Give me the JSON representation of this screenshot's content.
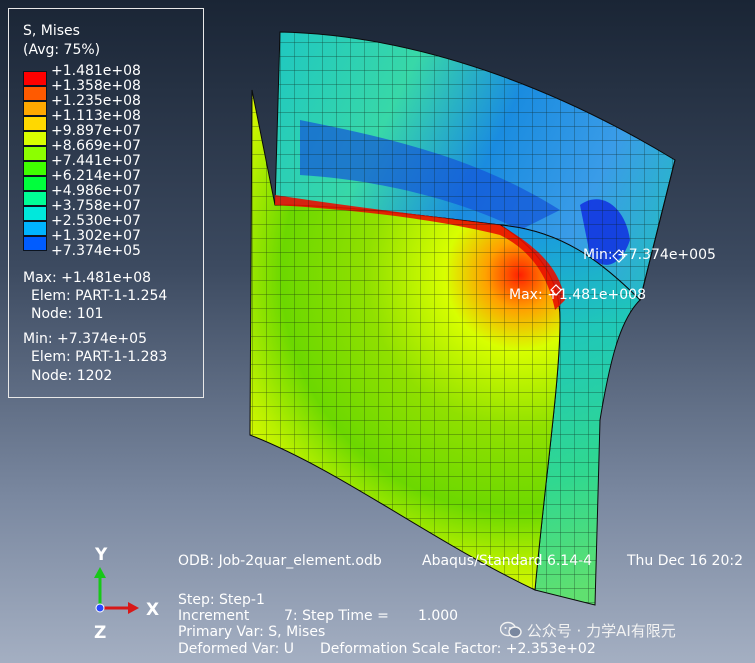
{
  "legend": {
    "title": "S, Mises",
    "subtitle": "(Avg: 75%)",
    "levels": [
      "+1.481e+08",
      "+1.358e+08",
      "+1.235e+08",
      "+1.113e+08",
      "+9.897e+07",
      "+8.669e+07",
      "+7.441e+07",
      "+6.214e+07",
      "+4.986e+07",
      "+3.758e+07",
      "+2.530e+07",
      "+1.302e+07",
      "+7.374e+05"
    ],
    "colors": [
      "#ff0000",
      "#ff5a00",
      "#ffa800",
      "#ffd800",
      "#d8ff00",
      "#8cff00",
      "#40ff00",
      "#00ff3c",
      "#00ff96",
      "#00e8dc",
      "#00b4ff",
      "#005cff",
      "#0000ff"
    ],
    "max_label": "Max: +1.481e+08",
    "max_elem": "Elem: PART-1-1.254",
    "max_node": "Node: 101",
    "min_label": "Min: +7.374e+05",
    "min_elem": "Elem: PART-1-1.283",
    "min_node": "Node: 1202"
  },
  "annotations": {
    "min": "Min: +7.374e+005",
    "max": "Max: +1.481e+008"
  },
  "footer": {
    "odb": "ODB: Job-2quar_element.odb",
    "solver": "Abaqus/Standard 6.14-4",
    "date": "Thu Dec 16 20:2",
    "step": "Step: Step-1",
    "increment_label": "Increment",
    "increment_value": "7: Step Time =",
    "step_time": "1.000",
    "primary_var": "Primary Var: S, Mises",
    "deformed_var": "Deformed Var: U",
    "scale_factor": "Deformation Scale Factor: +2.353e+02"
  },
  "triad": {
    "y": "Y",
    "x": "X",
    "z": "Z"
  },
  "watermark": "公众号 · 力学AI有限元",
  "icons": {
    "triad": "axis-triad-icon",
    "watermark": "wechat-icon"
  }
}
